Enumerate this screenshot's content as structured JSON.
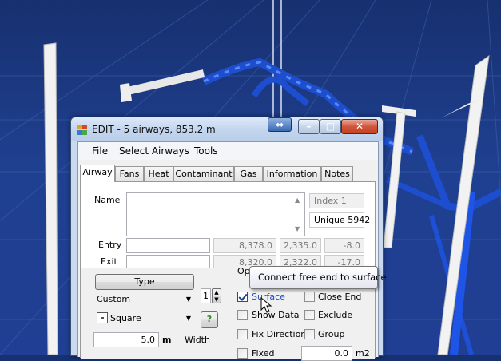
{
  "window": {
    "title": "EDIT -  5 airways, 853.2 m",
    "min_glyph": "–",
    "max_glyph": "□",
    "close_glyph": "✕",
    "resize_glyph": "⇔"
  },
  "menu": [
    "File",
    "Select Airways",
    "Tools"
  ],
  "tabs": [
    "Airway",
    "Fans",
    "Heat",
    "Contaminant",
    "Gas",
    "Information",
    "Notes"
  ],
  "airway": {
    "name_label": "Name",
    "index_value": "Index 1",
    "unique_value": "Unique 5942",
    "entry_label": "Entry",
    "exit_label": "Exit",
    "entry_coords": [
      "8,378.0",
      "2,335.0",
      "-8.0"
    ],
    "exit_coords": [
      "8,320.0",
      "2,322.0",
      "-17.0"
    ]
  },
  "type_section": {
    "type_button": "Type",
    "custom_value": "Custom",
    "spinner_value": "1",
    "shape_value": "Square",
    "help_button": "?",
    "dimension_value": "5.0",
    "dimension_unit": "m",
    "width_label": "Width"
  },
  "options": {
    "group_label": "Opt",
    "surface_label": "Surface",
    "close_end_label": "Close End",
    "show_data_label": "Show Data",
    "exclude_label": "Exclude",
    "fix_direction_label": "Fix Direction",
    "group_check_label": "Group",
    "fixed_label": "Fixed",
    "area_value": "0.0",
    "area_unit": "m2",
    "surface_checked": true
  },
  "tooltip": "Connect free end to surface",
  "colors": {
    "background": "#1f3d8c",
    "airway_blue": "#1a50e0",
    "shaft_white": "#f4f4f4",
    "title_blue": "#c4d6ee",
    "tooltip_border": "#767676"
  }
}
